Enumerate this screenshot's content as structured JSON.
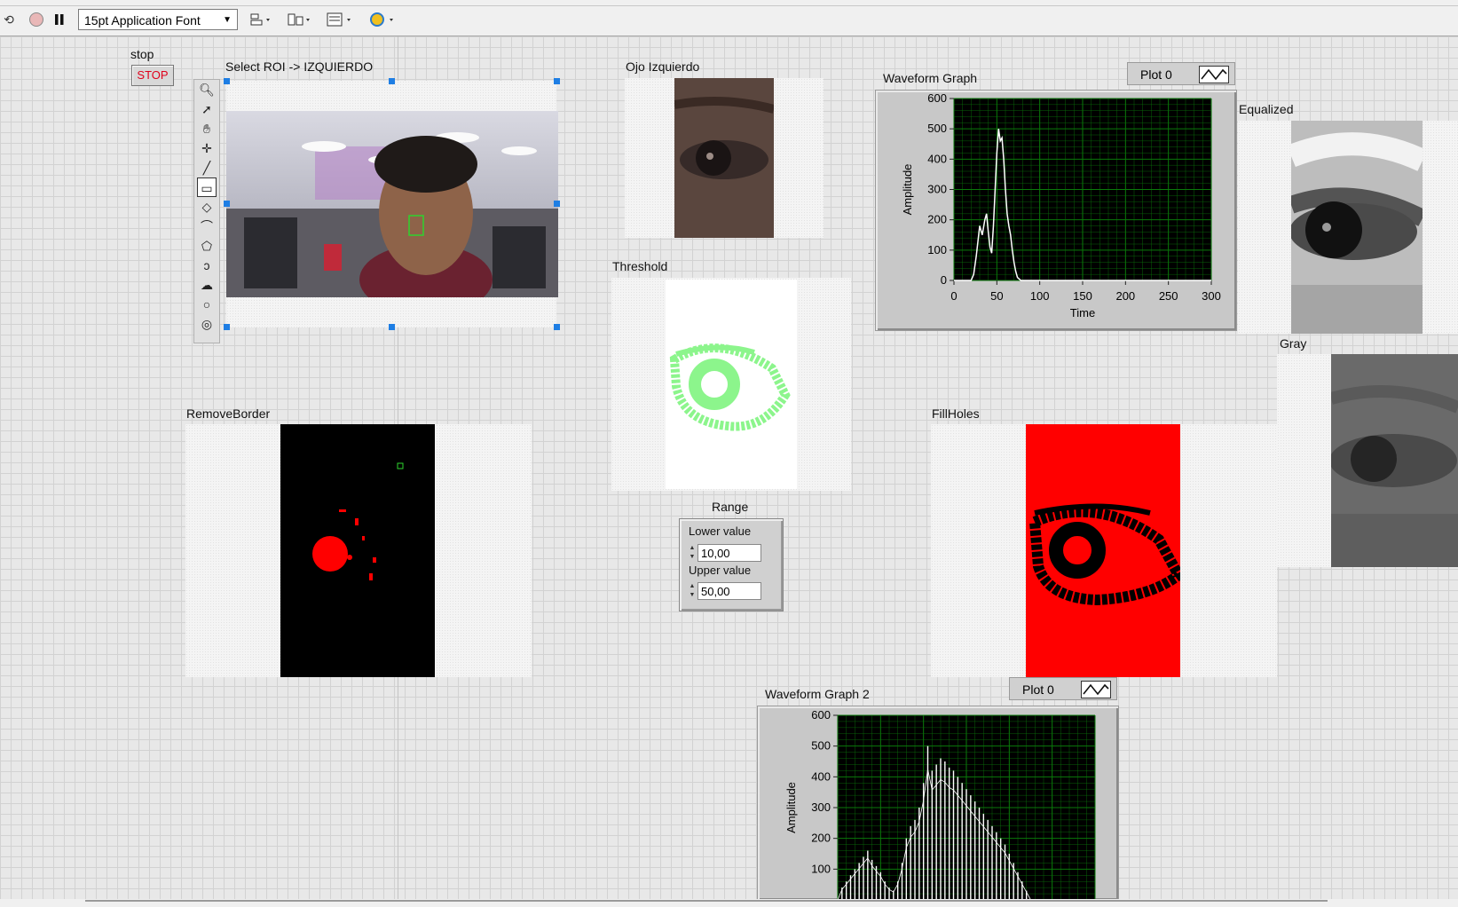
{
  "toolbar": {
    "font_select": "15pt Application Font",
    "icons": [
      "run-continuously-icon",
      "abort-icon",
      "pause-icon",
      "align-objects-icon",
      "distribute-objects-icon",
      "resize-objects-icon",
      "reorder-icon"
    ]
  },
  "controls": {
    "stop_label": "stop",
    "stop_button": "STOP",
    "roi_label": "Select ROI ->  IZQUIERDO",
    "ojo_label": "Ojo Izquierdo",
    "threshold_label": "Threshold",
    "equalized_label": "Equalized",
    "gray_label": "Gray",
    "removeborder_label": "RemoveBorder",
    "fillholes_label": "FillHoles"
  },
  "range": {
    "title": "Range",
    "lower_label": "Lower value",
    "lower_value": "10,00",
    "upper_label": "Upper value",
    "upper_value": "50,00"
  },
  "graph1": {
    "title": "Waveform Graph",
    "legend": "Plot 0",
    "ylabel": "Amplitude",
    "xlabel": "Time",
    "yticks": [
      "600",
      "500",
      "400",
      "300",
      "200",
      "100",
      "0"
    ],
    "xticks": [
      "0",
      "50",
      "100",
      "150",
      "200",
      "250",
      "300"
    ]
  },
  "graph2": {
    "title": "Waveform Graph 2",
    "legend": "Plot 0",
    "ylabel": "Amplitude",
    "yticks": [
      "600",
      "500",
      "400",
      "300",
      "200",
      "100"
    ]
  },
  "colors": {
    "plot_bg": "#000000",
    "grid": "#0a7a0a",
    "trace": "#ffffff",
    "threshold_fill": "#8cf58c",
    "mask_red": "#ff0000",
    "selection": "#1e7ee4"
  },
  "chart_data": [
    {
      "type": "line",
      "title": "Waveform Graph",
      "xlabel": "Time",
      "ylabel": "Amplitude",
      "xlim": [
        0,
        300
      ],
      "ylim": [
        0,
        600
      ],
      "series": [
        {
          "name": "Plot 0",
          "x": [
            0,
            20,
            23,
            26,
            28,
            30,
            33,
            36,
            38,
            40,
            42,
            44,
            46,
            48,
            50,
            52,
            54,
            56,
            58,
            60,
            62,
            64,
            66,
            68,
            70,
            72,
            74,
            76,
            78,
            80,
            85,
            90,
            300
          ],
          "y": [
            0,
            0,
            20,
            80,
            130,
            180,
            150,
            200,
            220,
            160,
            110,
            90,
            180,
            300,
            420,
            500,
            460,
            470,
            400,
            300,
            220,
            180,
            150,
            100,
            60,
            30,
            10,
            5,
            0,
            0,
            0,
            0,
            0
          ]
        }
      ]
    },
    {
      "type": "line",
      "title": "Waveform Graph 2",
      "ylabel": "Amplitude",
      "ylim": [
        0,
        600
      ],
      "series": [
        {
          "name": "Plot 0",
          "x": [
            0,
            5,
            10,
            15,
            20,
            25,
            30,
            35,
            40,
            45,
            50,
            55,
            60,
            65,
            70,
            75,
            80,
            85,
            90,
            95,
            100,
            105,
            110,
            115,
            120,
            125,
            130,
            135,
            140,
            145,
            150,
            155,
            160,
            165,
            170,
            175,
            180,
            185,
            190,
            195,
            200,
            205,
            210,
            215,
            220,
            225,
            230,
            235,
            240,
            245,
            250
          ],
          "y": [
            0,
            40,
            60,
            80,
            100,
            120,
            140,
            160,
            130,
            110,
            90,
            60,
            40,
            30,
            60,
            120,
            200,
            240,
            260,
            300,
            380,
            500,
            420,
            440,
            460,
            450,
            430,
            420,
            400,
            380,
            360,
            340,
            320,
            300,
            280,
            260,
            240,
            220,
            200,
            180,
            150,
            120,
            90,
            60,
            30,
            0,
            0,
            0,
            0,
            0,
            0
          ]
        }
      ]
    }
  ]
}
